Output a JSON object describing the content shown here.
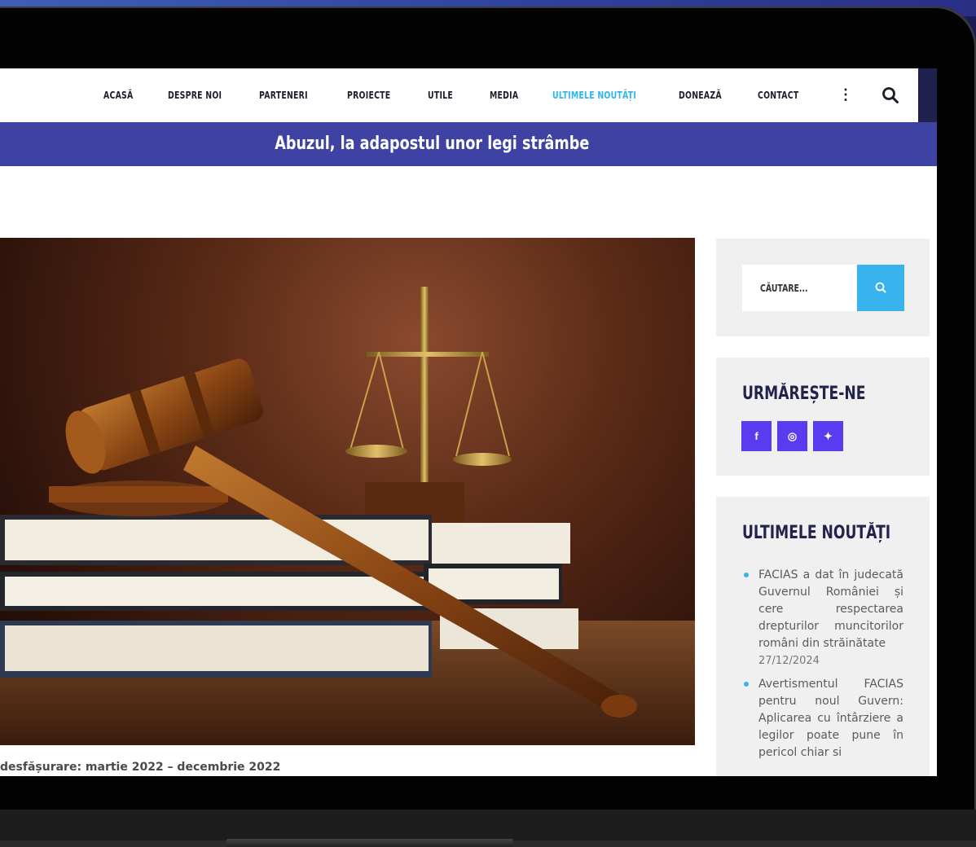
{
  "nav": {
    "items": [
      {
        "label": "ACASĂ",
        "active": false
      },
      {
        "label": "DESPRE NOI",
        "active": false
      },
      {
        "label": "PARTENERI",
        "active": false
      },
      {
        "label": "PROIECTE",
        "active": false
      },
      {
        "label": "UTILE",
        "active": false
      },
      {
        "label": "MEDIA",
        "active": false
      },
      {
        "label": "ULTIMELE NOUTĂȚI",
        "active": true
      },
      {
        "label": "DONEAZĂ",
        "active": false
      },
      {
        "label": "CONTACT",
        "active": false
      }
    ],
    "more_glyph": "⋮",
    "search_icon": "search-icon",
    "active_color": "#2fb6f2"
  },
  "page": {
    "title": "Abuzul, la adapostul unor legi strâmbe",
    "title_bar_color": "#3e42a2",
    "caption": "desfășurare: martie 2022 – decembrie 2022"
  },
  "sidebar": {
    "search": {
      "placeholder": "CĂUTARE...",
      "button_icon": "search-icon",
      "button_color": "#39b3ee"
    },
    "social": {
      "title": "URMĂREȘTE-NE",
      "icons": [
        {
          "name": "facebook-icon",
          "glyph": "f"
        },
        {
          "name": "instagram-icon",
          "glyph": "◎"
        },
        {
          "name": "twitter-icon",
          "glyph": "✦"
        }
      ],
      "icon_color": "#5a3bf0"
    },
    "news": {
      "title": "ULTIMELE NOUTĂȚI",
      "items": [
        {
          "text": "FACIAS a dat în judecată Guvernul României și cere respectarea drepturilor muncitorilor români din străinătate",
          "date": "27/12/2024"
        },
        {
          "text": "Avertismentul FACIAS pentru noul Guvern: Aplicarea cu întârziere a legilor poate pune în pericol chiar si",
          "date": ""
        }
      ]
    }
  }
}
